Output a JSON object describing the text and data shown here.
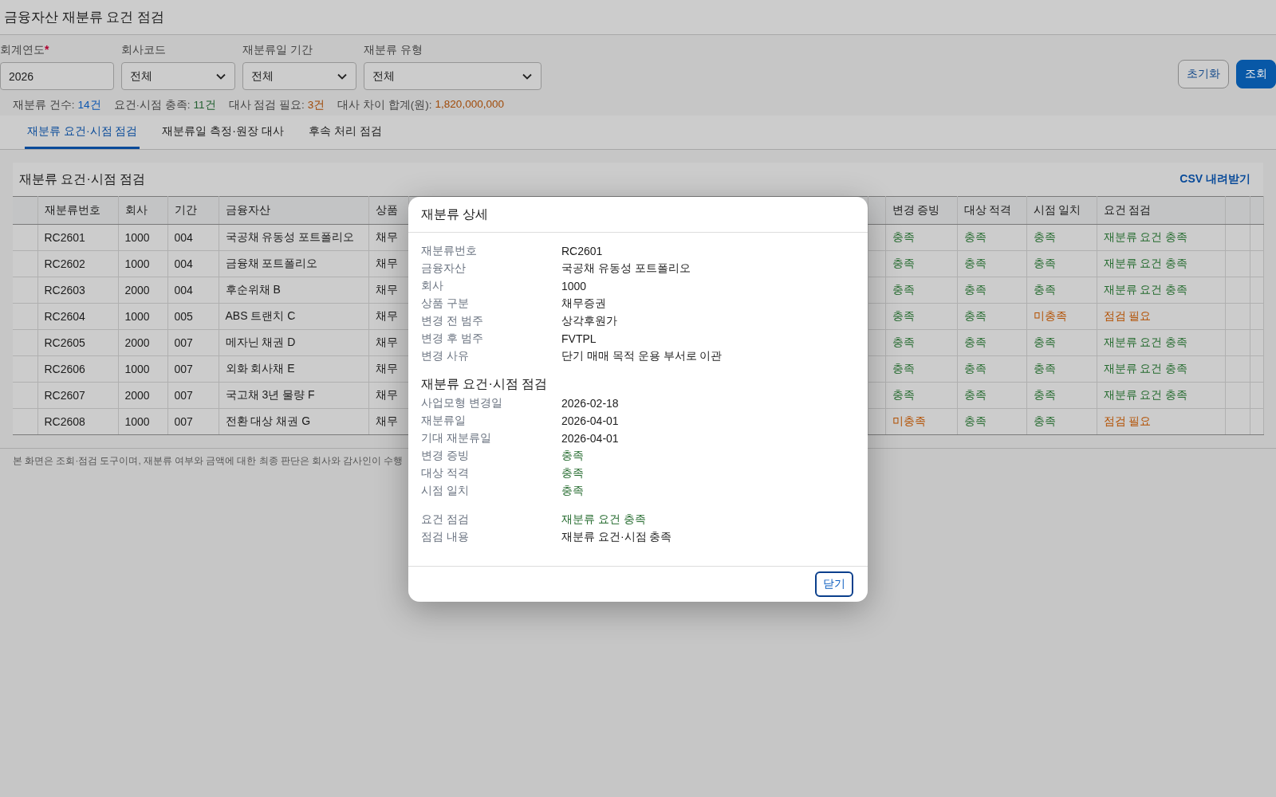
{
  "window": {
    "title": "금융자산 재분류 요건 점검"
  },
  "filters": [
    {
      "label": "회계연도",
      "required_mark": "*",
      "kind": "input",
      "value": "2026"
    },
    {
      "label": "회사코드",
      "kind": "select",
      "value": "전체"
    },
    {
      "label": "재분류일 기간",
      "kind": "select",
      "value": "전체"
    },
    {
      "label": "재분류 유형",
      "kind": "select",
      "value": "전체"
    }
  ],
  "actions": [
    {
      "label": "초기화",
      "kind": "secondary"
    },
    {
      "label": "조회",
      "kind": "primary"
    }
  ],
  "summary": [
    {
      "label": "재분류 건수:",
      "value": "14건",
      "color": "#0b56b0"
    },
    {
      "label": "요건·시점 충족:",
      "value": "11건",
      "color": "#226030"
    },
    {
      "label": "대사 점검 필요:",
      "value": "3건",
      "color": "#a04a08"
    },
    {
      "label": "대사 차이 합계(원):",
      "value": "1,820,000,000",
      "color": "#a04a08"
    }
  ],
  "tabs": [
    {
      "label": "재분류 요건·시점 점검",
      "selected": true
    },
    {
      "label": "재분류일 측정·원장 대사",
      "selected": false
    },
    {
      "label": "후속 처리 점검",
      "selected": false
    }
  ],
  "card": {
    "title": "재분류 요건·시점 점검",
    "download_link": "CSV 내려받기"
  },
  "table": {
    "columns_left": [
      "재분류번호",
      "회사",
      "기간",
      "금융자산",
      "상품"
    ],
    "columns_right": [
      "변경 증빙",
      "대상 적격",
      "시점 일치",
      "요건 점검"
    ],
    "rows": [
      {
        "id": "RC2601",
        "company": "1000",
        "period": "004",
        "asset": "국공채 유동성 포트폴리오",
        "product": "채무",
        "checks": [
          {
            "text": "충족",
            "color": "#256b2f"
          },
          {
            "text": "충족",
            "color": "#256b2f"
          },
          {
            "text": "충족",
            "color": "#256b2f"
          },
          {
            "text": "재분류 요건 충족",
            "color": "#256b2f"
          }
        ]
      },
      {
        "id": "RC2602",
        "company": "1000",
        "period": "004",
        "asset": "금융채 포트폴리오",
        "product": "채무",
        "checks": [
          {
            "text": "충족",
            "color": "#256b2f"
          },
          {
            "text": "충족",
            "color": "#256b2f"
          },
          {
            "text": "충족",
            "color": "#256b2f"
          },
          {
            "text": "재분류 요건 충족",
            "color": "#256b2f"
          }
        ]
      },
      {
        "id": "RC2603",
        "company": "2000",
        "period": "004",
        "asset": "후순위채 B",
        "product": "채무",
        "checks": [
          {
            "text": "충족",
            "color": "#256b2f"
          },
          {
            "text": "충족",
            "color": "#256b2f"
          },
          {
            "text": "충족",
            "color": "#256b2f"
          },
          {
            "text": "재분류 요건 충족",
            "color": "#256b2f"
          }
        ]
      },
      {
        "id": "RC2604",
        "company": "1000",
        "period": "005",
        "asset": "ABS 트랜치 C",
        "product": "채무",
        "checks": [
          {
            "text": "충족",
            "color": "#256b2f"
          },
          {
            "text": "충족",
            "color": "#256b2f"
          },
          {
            "text": "미충족",
            "color": "#b35000"
          },
          {
            "text": "점검 필요",
            "color": "#b35000"
          }
        ]
      },
      {
        "id": "RC2605",
        "company": "2000",
        "period": "007",
        "asset": "메자닌 채권 D",
        "product": "채무",
        "checks": [
          {
            "text": "충족",
            "color": "#256b2f"
          },
          {
            "text": "충족",
            "color": "#256b2f"
          },
          {
            "text": "충족",
            "color": "#256b2f"
          },
          {
            "text": "재분류 요건 충족",
            "color": "#256b2f"
          }
        ]
      },
      {
        "id": "RC2606",
        "company": "1000",
        "period": "007",
        "asset": "외화 회사채 E",
        "product": "채무",
        "checks": [
          {
            "text": "충족",
            "color": "#256b2f"
          },
          {
            "text": "충족",
            "color": "#256b2f"
          },
          {
            "text": "충족",
            "color": "#256b2f"
          },
          {
            "text": "재분류 요건 충족",
            "color": "#256b2f"
          }
        ]
      },
      {
        "id": "RC2607",
        "company": "2000",
        "period": "007",
        "asset": "국고채 3년 물량 F",
        "product": "채무",
        "checks": [
          {
            "text": "충족",
            "color": "#256b2f"
          },
          {
            "text": "충족",
            "color": "#256b2f"
          },
          {
            "text": "충족",
            "color": "#256b2f"
          },
          {
            "text": "재분류 요건 충족",
            "color": "#256b2f"
          }
        ]
      },
      {
        "id": "RC2608",
        "company": "1000",
        "period": "007",
        "asset": "전환 대상 채권 G",
        "product": "채무",
        "checks": [
          {
            "text": "미충족",
            "color": "#b35000"
          },
          {
            "text": "충족",
            "color": "#256b2f"
          },
          {
            "text": "충족",
            "color": "#256b2f"
          },
          {
            "text": "점검 필요",
            "color": "#b35000"
          }
        ]
      }
    ]
  },
  "footnote": "본 화면은 조회·점검 도구이며, 재분류 여부와 금액에 대한 최종 판단은 회사와 감사인이 수행",
  "dialog": {
    "title": "재분류 상세",
    "groups": [
      {
        "fields": [
          {
            "label": "재분류번호",
            "value": "RC2601"
          },
          {
            "label": "금융자산",
            "value": "국공채 유동성 포트폴리오"
          },
          {
            "label": "회사",
            "value": "1000"
          },
          {
            "label": "상품 구분",
            "value": "채무증권"
          },
          {
            "label": "변경 전 범주",
            "value": "상각후원가"
          },
          {
            "label": "변경 후 범주",
            "value": "FVTPL"
          },
          {
            "label": "변경 사유",
            "value": "단기 매매 목적 운용 부서로 이관"
          }
        ]
      },
      {
        "heading": "재분류 요건·시점 점검",
        "fields": [
          {
            "label": "사업모형 변경일",
            "value": "2026-02-18"
          },
          {
            "label": "재분류일",
            "value": "2026-04-01"
          },
          {
            "label": "기대 재분류일",
            "value": "2026-04-01"
          },
          {
            "label": "변경 증빙",
            "value": "충족",
            "color": "#256b2f"
          },
          {
            "label": "대상 적격",
            "value": "충족",
            "color": "#256b2f"
          },
          {
            "label": "시점 일치",
            "value": "충족",
            "color": "#256b2f"
          }
        ]
      },
      {
        "fields": [
          {
            "label": "요건 점검",
            "value": "재분류 요건 충족",
            "color": "#256b2f"
          },
          {
            "label": "점검 내용",
            "value": "재분류 요건·시점 충족"
          }
        ]
      }
    ],
    "close_button": "닫기"
  }
}
